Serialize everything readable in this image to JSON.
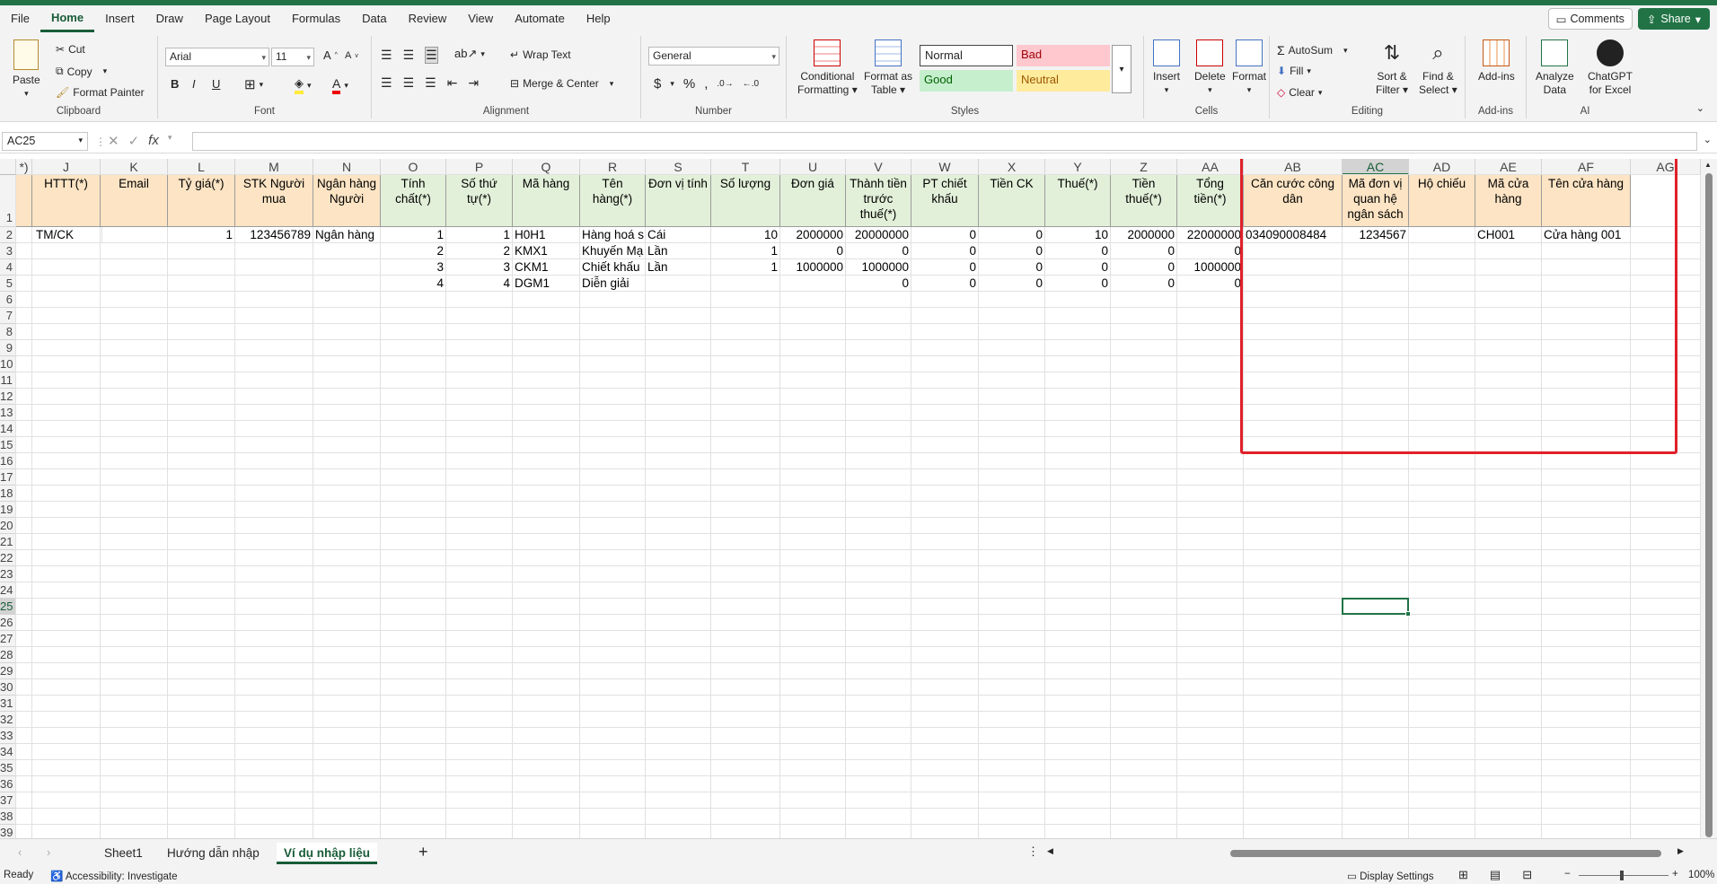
{
  "menu": {
    "items": [
      "File",
      "Home",
      "Insert",
      "Draw",
      "Page Layout",
      "Formulas",
      "Data",
      "Review",
      "View",
      "Automate",
      "Help"
    ],
    "active": "Home",
    "comments_label": "Comments",
    "share_label": "Share"
  },
  "ribbon": {
    "clipboard": {
      "paste": "Paste",
      "cut": "Cut",
      "copy": "Copy",
      "format_painter": "Format Painter",
      "label": "Clipboard"
    },
    "font": {
      "name": "Arial",
      "size": "11",
      "label": "Font",
      "bold": "B",
      "italic": "I",
      "underline": "U"
    },
    "alignment": {
      "wrap_text": "Wrap Text",
      "merge_center": "Merge & Center",
      "label": "Alignment"
    },
    "number": {
      "format": "General",
      "label": "Number",
      "currency": "$",
      "percent": "%"
    },
    "styles": {
      "conditional": "Conditional",
      "formatting": "Formatting",
      "format_as": "Format as",
      "table": "Table",
      "normal": "Normal",
      "bad": "Bad",
      "good": "Good",
      "neutral": "Neutral",
      "label": "Styles"
    },
    "cells": {
      "insert": "Insert",
      "delete": "Delete",
      "format": "Format",
      "label": "Cells"
    },
    "editing": {
      "autosum": "AutoSum",
      "fill": "Fill",
      "clear": "Clear",
      "sort": "Sort &",
      "filter": "Filter",
      "find": "Find &",
      "select": "Select",
      "label": "Editing"
    },
    "addins": {
      "addins": "Add-ins",
      "label": "Add-ins"
    },
    "ai": {
      "analyze": "Analyze",
      "data": "Data",
      "chatgpt": "ChatGPT",
      "for_excel": "for Excel",
      "label": "AI"
    }
  },
  "formula_bar": {
    "name_box": "AC25",
    "fx": "fx",
    "value": ""
  },
  "grid": {
    "columns": [
      "*)",
      "J",
      "K",
      "L",
      "M",
      "N",
      "O",
      "P",
      "Q",
      "R",
      "S",
      "T",
      "U",
      "V",
      "W",
      "X",
      "Y",
      "Z",
      "AA",
      "AB",
      "AC",
      "AD",
      "AE",
      "AF",
      "AG"
    ],
    "selected_column": "AC",
    "selected_row": "25",
    "rows": [
      "1",
      "2",
      "3",
      "4",
      "5",
      "6",
      "7",
      "8",
      "9",
      "10",
      "11",
      "12",
      "13",
      "14",
      "15",
      "16",
      "17",
      "18",
      "19",
      "20",
      "21",
      "22",
      "23",
      "24",
      "25",
      "26",
      "27",
      "28",
      "29",
      "30",
      "31",
      "32",
      "33",
      "34",
      "35",
      "36",
      "37",
      "38",
      "39"
    ],
    "header_cells": [
      "HTTT(*)",
      "Email",
      "Tỷ giá(*)",
      "STK Người mua",
      "Ngân hàng Người",
      "Tính chất(*)",
      "Số thứ tự(*)",
      "Mã hàng",
      "Tên hàng(*)",
      "Đơn vị tính",
      "Số lượng",
      "Đơn giá",
      "Thành tiền trước thuế(*)",
      "PT chiết khấu",
      "Tiền CK",
      "Thuế(*)",
      "Tiền thuế(*)",
      "Tổng tiền(*)",
      "Căn cước công dân",
      "Mã đơn vị quan hệ ngân sách",
      "Hộ chiếu",
      "Mã cửa hàng",
      "Tên cửa hàng"
    ],
    "data_rows": [
      [
        "TM/CK",
        "",
        "1",
        "123456789",
        "Ngân hàng",
        "1",
        "1",
        "H0H1",
        "Hàng hoá s",
        "Cái",
        "10",
        "2000000",
        "20000000",
        "0",
        "0",
        "10",
        "2000000",
        "22000000",
        "034090008484",
        "1234567",
        "",
        "CH001",
        "Cửa hàng 001"
      ],
      [
        "",
        "",
        "",
        "",
        "",
        "2",
        "2",
        "KMX1",
        "Khuyến Mạ",
        "Lần",
        "1",
        "0",
        "0",
        "0",
        "0",
        "0",
        "0",
        "0",
        "",
        "",
        "",
        "",
        ""
      ],
      [
        "",
        "",
        "",
        "",
        "",
        "3",
        "3",
        "CKM1",
        "Chiết khấu",
        "Lần",
        "1",
        "1000000",
        "1000000",
        "0",
        "0",
        "0",
        "0",
        "1000000",
        "",
        "",
        "",
        "",
        ""
      ],
      [
        "",
        "",
        "",
        "",
        "",
        "4",
        "4",
        "DGM1",
        "Diễn giải",
        "",
        "",
        "",
        "0",
        "0",
        "0",
        "0",
        "0",
        "0",
        "",
        "",
        "",
        "",
        ""
      ]
    ]
  },
  "sheets": {
    "tabs": [
      "Sheet1",
      "Hướng dẫn nhập",
      "Ví dụ nhập liệu"
    ],
    "active": "Ví dụ nhập liệu",
    "add": "+"
  },
  "status": {
    "ready": "Ready",
    "accessibility": "Accessibility: Investigate",
    "display_settings": "Display Settings",
    "zoom": "100%"
  }
}
